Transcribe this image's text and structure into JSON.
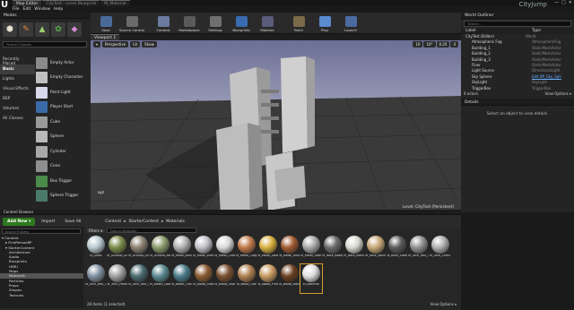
{
  "window": {
    "logo": "U",
    "tabs": [
      "Map Editor",
      "CityTest - Level Blueprint",
      "M_Material"
    ],
    "app_title": "CityJump",
    "controls": [
      "—",
      "□",
      "✕"
    ]
  },
  "menu": [
    "File",
    "Edit",
    "Window",
    "Help"
  ],
  "modes": {
    "title": "Modes",
    "icons": [
      {
        "name": "place-mode-icon",
        "glyph": "⬢",
        "color": "#e8e2d0"
      },
      {
        "name": "paint-mode-icon",
        "glyph": "✎",
        "color": "#e88a3a"
      },
      {
        "name": "landscape-mode-icon",
        "glyph": "▲",
        "color": "#9ad06a"
      },
      {
        "name": "foliage-mode-icon",
        "glyph": "✿",
        "color": "#56b04a"
      },
      {
        "name": "geometry-mode-icon",
        "glyph": "◆",
        "color": "#d08ad0"
      }
    ],
    "search_placeholder": "Search Classes",
    "categories": [
      "Recently Placed",
      "Basic",
      "Lights",
      "Visual Effects",
      "BSP",
      "Volumes",
      "All Classes"
    ],
    "selected_category": "Basic",
    "items": [
      {
        "label": "Empty Actor",
        "color": "#8a8a8a"
      },
      {
        "label": "Empty Character",
        "color": "#c0c0c0"
      },
      {
        "label": "Point Light",
        "color": "#d8d8ea"
      },
      {
        "label": "Player Start",
        "color": "#3b6aa8"
      },
      {
        "label": "Cube",
        "color": "#9a9a9a"
      },
      {
        "label": "Sphere",
        "color": "#b8b8b8"
      },
      {
        "label": "Cylinder",
        "color": "#a8a8a8"
      },
      {
        "label": "Cone",
        "color": "#8f8f8f"
      },
      {
        "label": "Box Trigger",
        "color": "#4a8a4a"
      },
      {
        "label": "Sphere Trigger",
        "color": "#4a7a6a"
      }
    ]
  },
  "toolbar": {
    "buttons": [
      {
        "label": "Save",
        "color": "#4a6a9a"
      },
      {
        "label": "Source Control",
        "color": "#6a6a6a"
      },
      {
        "label": "Content",
        "color": "#6a7aa0"
      },
      {
        "label": "Marketplace",
        "color": "#5a5a5a"
      },
      {
        "label": "Settings",
        "color": "#707070"
      },
      {
        "label": "Blueprints",
        "color": "#3a6ab0"
      },
      {
        "label": "Matinee",
        "color": "#5a5a7a"
      },
      {
        "label": "Build",
        "color": "#7a6a4a"
      },
      {
        "label": "Play",
        "color": "#5a8ad0"
      },
      {
        "label": "Launch",
        "color": "#4a6aa0"
      }
    ]
  },
  "viewport": {
    "tab": "Viewport 1",
    "controls": [
      "▾",
      "Perspective",
      "Lit",
      "Show"
    ],
    "right_controls": [
      "10",
      "10°",
      "0.25",
      "4"
    ],
    "level_label": "Level: CityTest (Persistent)",
    "axis_label": "xyz"
  },
  "outliner": {
    "title": "World Outliner",
    "search_placeholder": "Search...",
    "col_label": "Label",
    "col_type": "Type",
    "rows": [
      {
        "label": "CityTest (Editor)",
        "type": "World"
      },
      {
        "label": "Atmospheric Fog",
        "type": "AtmosphericFog"
      },
      {
        "label": "Building_1",
        "type": "StaticMeshActor"
      },
      {
        "label": "Building_2",
        "type": "StaticMeshActor"
      },
      {
        "label": "Building_3",
        "type": "StaticMeshActor"
      },
      {
        "label": "Floor",
        "type": "StaticMeshActor"
      },
      {
        "label": "Light Source",
        "type": "DirectionalLight"
      },
      {
        "label": "Sky Sphere",
        "type": "Edit BP_Sky_Sph",
        "link": true
      },
      {
        "label": "SkyLight",
        "type": "SkyLight"
      },
      {
        "label": "TriggerBox",
        "type": "TriggerBox"
      }
    ],
    "count": "9 actors",
    "view_options": "View Options ▾"
  },
  "details": {
    "title": "Details",
    "hint": "Select an object to view details."
  },
  "content_browser": {
    "title": "Content Browser",
    "add_new": "Add New ▾",
    "import": "Import",
    "save_all": "Save All",
    "breadcrumb": [
      "Content",
      "StarterContent",
      "Materials"
    ],
    "folder_search_placeholder": "Search Folders",
    "filters": "Filters ▾",
    "asset_search_placeholder": "Search Materials",
    "tree": [
      {
        "label": "▾ Content",
        "indent": 0
      },
      {
        "label": "▸ FirstPersonBP",
        "indent": 1
      },
      {
        "label": "▾ StarterContent",
        "indent": 1
      },
      {
        "label": "Architecture",
        "indent": 2
      },
      {
        "label": "Audio",
        "indent": 2
      },
      {
        "label": "Blueprints",
        "indent": 2
      },
      {
        "label": "HDRI",
        "indent": 2
      },
      {
        "label": "Maps",
        "indent": 2
      },
      {
        "label": "Materials",
        "indent": 2,
        "sel": true
      },
      {
        "label": "Particles",
        "indent": 2
      },
      {
        "label": "Props",
        "indent": 2
      },
      {
        "label": "Shapes",
        "indent": 2
      },
      {
        "label": "Textures",
        "indent": 2
      }
    ],
    "assets": [
      {
        "label": "M_Glass",
        "color": "#b8c8d0"
      },
      {
        "label": "M_Ground_Grass",
        "color": "#7a8a4a"
      },
      {
        "label": "M_Ground_Gravel",
        "color": "#8a8070"
      },
      {
        "label": "M_Ground_Moss",
        "color": "#8a9a6a"
      },
      {
        "label": "M_Metal_Brushed_Nickel",
        "color": "#b0b0b0"
      },
      {
        "label": "M_Metal_Burnished_Steel",
        "color": "#c0c0c8"
      },
      {
        "label": "M_Metal_Chrome",
        "color": "#d8d8d8"
      },
      {
        "label": "M_Metal_Copper",
        "color": "#c07a4a"
      },
      {
        "label": "M_Metal_Gold",
        "color": "#d8b040"
      },
      {
        "label": "M_Metal_Rust",
        "color": "#a05a30"
      },
      {
        "label": "M_Metal_Steel",
        "color": "#a8a8a8"
      },
      {
        "label": "M_Rock_Basalt",
        "color": "#6a6a6a"
      },
      {
        "label": "M_Rock_Marble_Polished",
        "color": "#d8d8d0"
      },
      {
        "label": "M_Rock_Sandstone",
        "color": "#c8a878"
      },
      {
        "label": "M_Rock_Slate",
        "color": "#5a5a5a"
      },
      {
        "label": "M_Tech_Hex_Tile",
        "color": "#909090"
      },
      {
        "label": "M_Tech_Checker_Dot",
        "color": "#b0b0b0"
      },
      {
        "label": "M_Tech_Hex_Tile_Pulse",
        "color": "#8090a0"
      },
      {
        "label": "M_Tech_Panel",
        "color": "#a0a0a0"
      },
      {
        "label": "M_Tech_Hex_Tile",
        "color": "#4a6a70"
      },
      {
        "label": "M_Water_Lake",
        "color": "#5a8a90"
      },
      {
        "label": "M_Water_Ocean",
        "color": "#4a7a88"
      },
      {
        "label": "M_Wood_Floor_Walnut_Polished",
        "color": "#8a5a30"
      },
      {
        "label": "M_Wood_Floor_Walnut_Worn",
        "color": "#7a5030"
      },
      {
        "label": "M_Wood_Oak",
        "color": "#b08050"
      },
      {
        "label": "M_Wood_Pine",
        "color": "#c89a60"
      },
      {
        "label": "M_Wood_Walnut",
        "color": "#6a4020"
      },
      {
        "label": "M_Material",
        "color": "#e0e0e0"
      }
    ],
    "status": "28 items (1 selected)",
    "view_options": "View Options ▾"
  }
}
